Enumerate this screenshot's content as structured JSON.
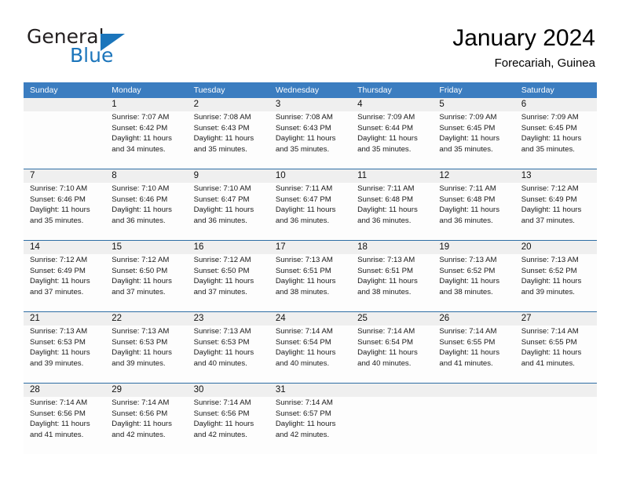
{
  "logo": {
    "word1": "General",
    "word2": "Blue",
    "mark": "triangle-logo-icon",
    "color_dark": "#231f20",
    "color_blue": "#1b75bb"
  },
  "header": {
    "title": "January 2024",
    "subtitle": "Forecariah, Guinea"
  },
  "theme": {
    "header_bg": "#3b7dc0",
    "header_text": "#ffffff",
    "daynum_bg": "#efefef",
    "cell_bg": "#fdfdfd",
    "row_divider": "#2e6da4"
  },
  "weekdays": [
    "Sunday",
    "Monday",
    "Tuesday",
    "Wednesday",
    "Thursday",
    "Friday",
    "Saturday"
  ],
  "weeks": [
    [
      {
        "day": "",
        "lines": []
      },
      {
        "day": "1",
        "lines": [
          "Sunrise: 7:07 AM",
          "Sunset: 6:42 PM",
          "Daylight: 11 hours",
          "and 34 minutes."
        ]
      },
      {
        "day": "2",
        "lines": [
          "Sunrise: 7:08 AM",
          "Sunset: 6:43 PM",
          "Daylight: 11 hours",
          "and 35 minutes."
        ]
      },
      {
        "day": "3",
        "lines": [
          "Sunrise: 7:08 AM",
          "Sunset: 6:43 PM",
          "Daylight: 11 hours",
          "and 35 minutes."
        ]
      },
      {
        "day": "4",
        "lines": [
          "Sunrise: 7:09 AM",
          "Sunset: 6:44 PM",
          "Daylight: 11 hours",
          "and 35 minutes."
        ]
      },
      {
        "day": "5",
        "lines": [
          "Sunrise: 7:09 AM",
          "Sunset: 6:45 PM",
          "Daylight: 11 hours",
          "and 35 minutes."
        ]
      },
      {
        "day": "6",
        "lines": [
          "Sunrise: 7:09 AM",
          "Sunset: 6:45 PM",
          "Daylight: 11 hours",
          "and 35 minutes."
        ]
      }
    ],
    [
      {
        "day": "7",
        "lines": [
          "Sunrise: 7:10 AM",
          "Sunset: 6:46 PM",
          "Daylight: 11 hours",
          "and 35 minutes."
        ]
      },
      {
        "day": "8",
        "lines": [
          "Sunrise: 7:10 AM",
          "Sunset: 6:46 PM",
          "Daylight: 11 hours",
          "and 36 minutes."
        ]
      },
      {
        "day": "9",
        "lines": [
          "Sunrise: 7:10 AM",
          "Sunset: 6:47 PM",
          "Daylight: 11 hours",
          "and 36 minutes."
        ]
      },
      {
        "day": "10",
        "lines": [
          "Sunrise: 7:11 AM",
          "Sunset: 6:47 PM",
          "Daylight: 11 hours",
          "and 36 minutes."
        ]
      },
      {
        "day": "11",
        "lines": [
          "Sunrise: 7:11 AM",
          "Sunset: 6:48 PM",
          "Daylight: 11 hours",
          "and 36 minutes."
        ]
      },
      {
        "day": "12",
        "lines": [
          "Sunrise: 7:11 AM",
          "Sunset: 6:48 PM",
          "Daylight: 11 hours",
          "and 36 minutes."
        ]
      },
      {
        "day": "13",
        "lines": [
          "Sunrise: 7:12 AM",
          "Sunset: 6:49 PM",
          "Daylight: 11 hours",
          "and 37 minutes."
        ]
      }
    ],
    [
      {
        "day": "14",
        "lines": [
          "Sunrise: 7:12 AM",
          "Sunset: 6:49 PM",
          "Daylight: 11 hours",
          "and 37 minutes."
        ]
      },
      {
        "day": "15",
        "lines": [
          "Sunrise: 7:12 AM",
          "Sunset: 6:50 PM",
          "Daylight: 11 hours",
          "and 37 minutes."
        ]
      },
      {
        "day": "16",
        "lines": [
          "Sunrise: 7:12 AM",
          "Sunset: 6:50 PM",
          "Daylight: 11 hours",
          "and 37 minutes."
        ]
      },
      {
        "day": "17",
        "lines": [
          "Sunrise: 7:13 AM",
          "Sunset: 6:51 PM",
          "Daylight: 11 hours",
          "and 38 minutes."
        ]
      },
      {
        "day": "18",
        "lines": [
          "Sunrise: 7:13 AM",
          "Sunset: 6:51 PM",
          "Daylight: 11 hours",
          "and 38 minutes."
        ]
      },
      {
        "day": "19",
        "lines": [
          "Sunrise: 7:13 AM",
          "Sunset: 6:52 PM",
          "Daylight: 11 hours",
          "and 38 minutes."
        ]
      },
      {
        "day": "20",
        "lines": [
          "Sunrise: 7:13 AM",
          "Sunset: 6:52 PM",
          "Daylight: 11 hours",
          "and 39 minutes."
        ]
      }
    ],
    [
      {
        "day": "21",
        "lines": [
          "Sunrise: 7:13 AM",
          "Sunset: 6:53 PM",
          "Daylight: 11 hours",
          "and 39 minutes."
        ]
      },
      {
        "day": "22",
        "lines": [
          "Sunrise: 7:13 AM",
          "Sunset: 6:53 PM",
          "Daylight: 11 hours",
          "and 39 minutes."
        ]
      },
      {
        "day": "23",
        "lines": [
          "Sunrise: 7:13 AM",
          "Sunset: 6:53 PM",
          "Daylight: 11 hours",
          "and 40 minutes."
        ]
      },
      {
        "day": "24",
        "lines": [
          "Sunrise: 7:14 AM",
          "Sunset: 6:54 PM",
          "Daylight: 11 hours",
          "and 40 minutes."
        ]
      },
      {
        "day": "25",
        "lines": [
          "Sunrise: 7:14 AM",
          "Sunset: 6:54 PM",
          "Daylight: 11 hours",
          "and 40 minutes."
        ]
      },
      {
        "day": "26",
        "lines": [
          "Sunrise: 7:14 AM",
          "Sunset: 6:55 PM",
          "Daylight: 11 hours",
          "and 41 minutes."
        ]
      },
      {
        "day": "27",
        "lines": [
          "Sunrise: 7:14 AM",
          "Sunset: 6:55 PM",
          "Daylight: 11 hours",
          "and 41 minutes."
        ]
      }
    ],
    [
      {
        "day": "28",
        "lines": [
          "Sunrise: 7:14 AM",
          "Sunset: 6:56 PM",
          "Daylight: 11 hours",
          "and 41 minutes."
        ]
      },
      {
        "day": "29",
        "lines": [
          "Sunrise: 7:14 AM",
          "Sunset: 6:56 PM",
          "Daylight: 11 hours",
          "and 42 minutes."
        ]
      },
      {
        "day": "30",
        "lines": [
          "Sunrise: 7:14 AM",
          "Sunset: 6:56 PM",
          "Daylight: 11 hours",
          "and 42 minutes."
        ]
      },
      {
        "day": "31",
        "lines": [
          "Sunrise: 7:14 AM",
          "Sunset: 6:57 PM",
          "Daylight: 11 hours",
          "and 42 minutes."
        ]
      },
      {
        "day": "",
        "lines": []
      },
      {
        "day": "",
        "lines": []
      },
      {
        "day": "",
        "lines": []
      }
    ]
  ]
}
